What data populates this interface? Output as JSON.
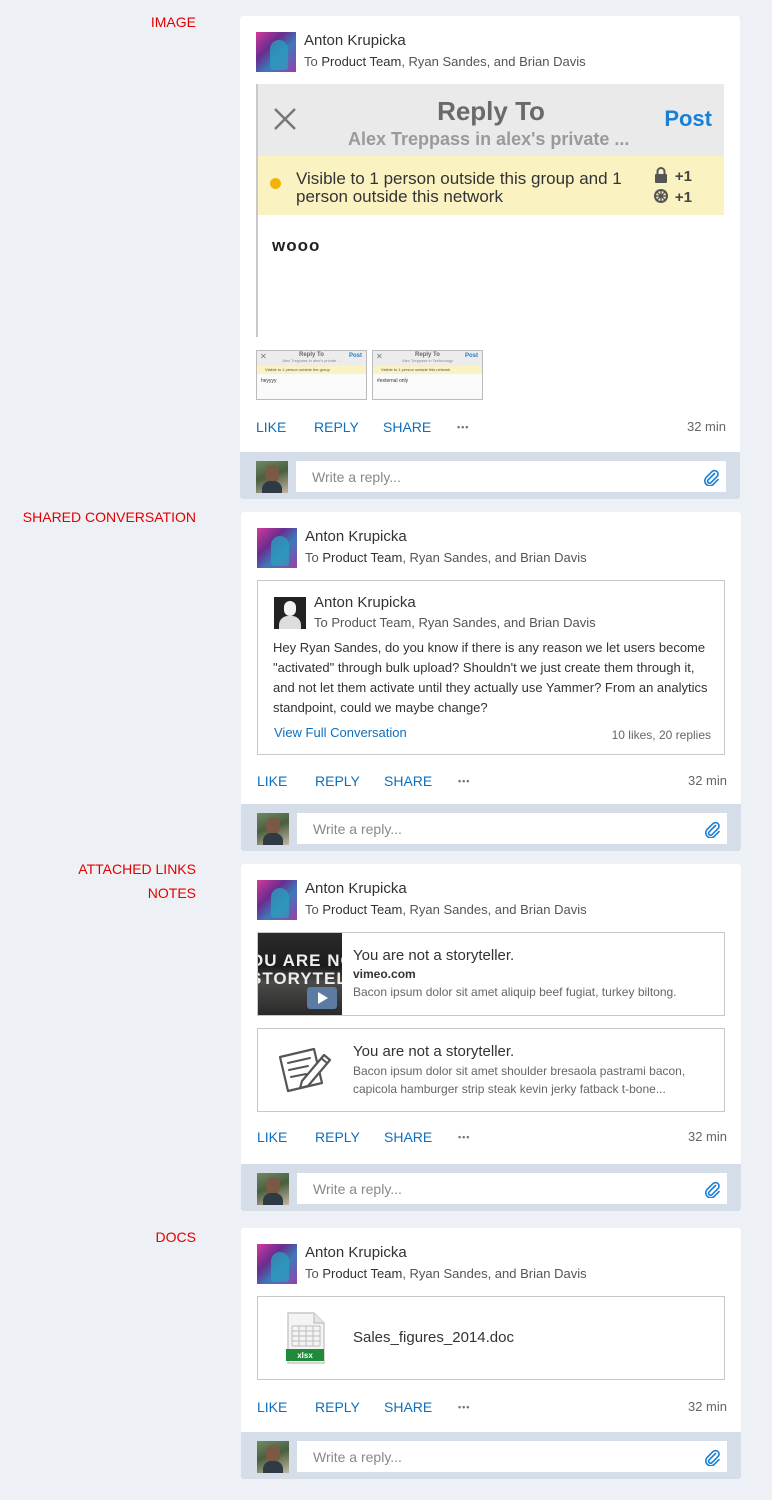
{
  "sections": {
    "image": "IMAGE",
    "shared": "SHARED CONVERSATION",
    "links_line1": "ATTACHED LINKS",
    "links_line2": "NOTES",
    "docs": "DOCS"
  },
  "post": {
    "author": "Anton Krupicka",
    "to": "To ",
    "recipient_group": "Product Team",
    "recipient_rest": ", Ryan Sandes, and Brian Davis",
    "actions": {
      "like": "LIKE",
      "reply": "REPLY",
      "share": "SHARE",
      "more": "•••"
    },
    "time": "32 min",
    "reply_placeholder": "Write a reply..."
  },
  "image_post": {
    "screenshot": {
      "title": "Reply To",
      "subtitle": "Alex Treppass in alex's private ...",
      "post_label": "Post",
      "warning": "Visible to 1 person outside this group and 1 person outside this network",
      "lock_count": "+1",
      "network_count": "+1",
      "body": "wooo"
    },
    "thumbnails": [
      {
        "title": "Reply To",
        "subtitle": "Alex Treppass in alex's private ...",
        "post": "Post",
        "warning": "Visible to 1 person outside the group",
        "body": "heyyyy"
      },
      {
        "title": "Reply To",
        "subtitle": "Alex Treppass in Technology",
        "post": "Post",
        "warning": "Visible to 1 person outside this network",
        "body": "#external only"
      }
    ]
  },
  "shared_post": {
    "author": "Anton Krupicka",
    "to": "To Product Team, Ryan Sandes, and Brian Davis",
    "body": "Hey Ryan Sandes, do you know if there is any reason we let users become \"activated\" through bulk upload? Shouldn't we just create them through it, and not let them activate until they actually use Yammer? From an analytics standpoint, could we maybe change?",
    "view_link": "View Full Conversation",
    "stats": "10 likes, 20 replies"
  },
  "link_post": {
    "video_thumb_line1": "OU ARE NOT",
    "video_thumb_line2": "STORYTELLER",
    "link_title": "You are not a storyteller.",
    "link_domain": "vimeo.com",
    "link_desc": "Bacon ipsum dolor sit amet aliquip beef fugiat, turkey biltong.",
    "note_title": "You are not a storyteller.",
    "note_desc": "Bacon ipsum dolor sit amet shoulder bresaola pastrami bacon, capicola hamburger strip steak kevin jerky fatback t-bone..."
  },
  "doc_post": {
    "file_name": "Sales_figures_2014.doc",
    "file_badge": "xlsx"
  },
  "colors": {
    "accent": "#0e6fbe",
    "section_label": "#e30000",
    "page_bg": "#edf0f4",
    "reply_bar": "#d4dde8",
    "warning_bg": "#fbf2c2"
  },
  "icons": [
    "attach-icon",
    "close-icon",
    "lock-icon",
    "network-icon",
    "play-icon",
    "note-icon",
    "document-icon"
  ]
}
